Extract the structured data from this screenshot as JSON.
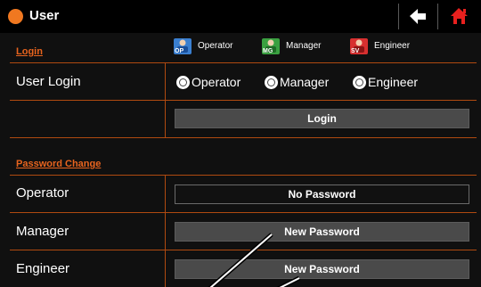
{
  "window": {
    "title": "User"
  },
  "colors": {
    "accent": "#f07820",
    "home": "#e8201e",
    "operator_icon": "#3a7fd0",
    "manager_icon": "#3aa040",
    "engineer_icon": "#d83030"
  },
  "icons": {
    "back": "arrow-left-icon",
    "home": "home-icon"
  },
  "login": {
    "section_label": "Login",
    "legend": [
      {
        "label": "Operator",
        "tag": "OP",
        "icon": "operator-icon"
      },
      {
        "label": "Manager",
        "tag": "MG",
        "icon": "manager-icon"
      },
      {
        "label": "Engineer",
        "tag": "SV",
        "icon": "engineer-icon"
      }
    ],
    "user_login_label": "User Login",
    "options": [
      {
        "label": "Operator"
      },
      {
        "label": "Manager"
      },
      {
        "label": "Engineer"
      }
    ],
    "login_button": "Login"
  },
  "password": {
    "section_label": "Password Change",
    "rows": [
      {
        "label": "Operator",
        "button": "No Password"
      },
      {
        "label": "Manager",
        "button": "New Password"
      },
      {
        "label": "Engineer",
        "button": "New Password"
      }
    ]
  }
}
